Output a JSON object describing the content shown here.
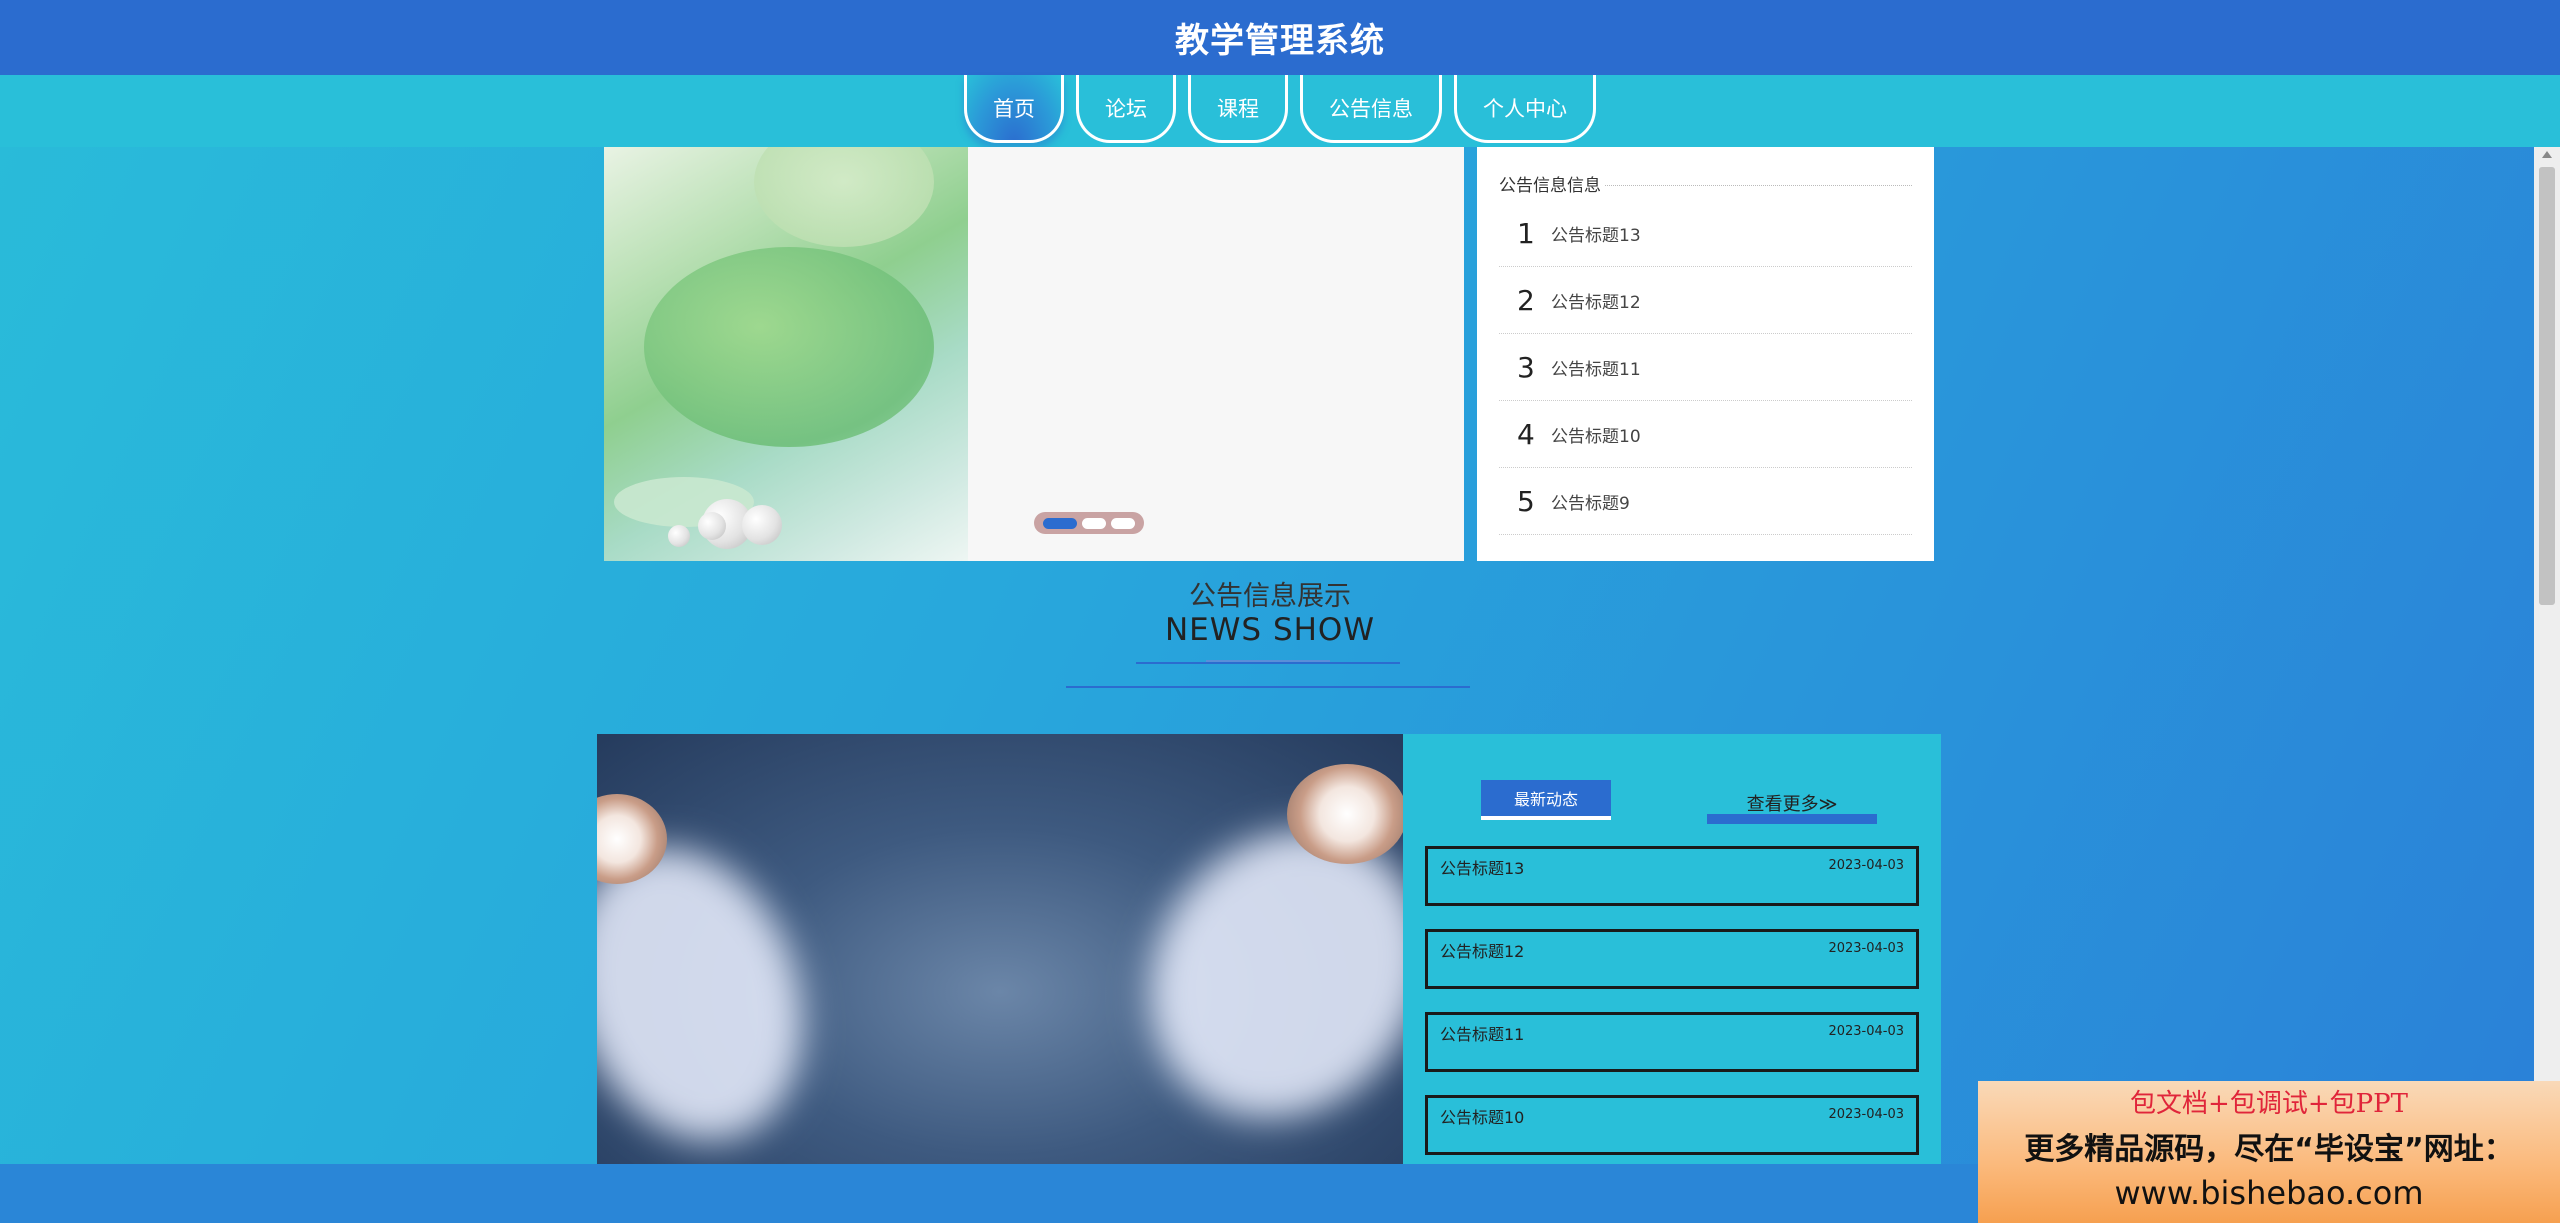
{
  "header": {
    "title": "教学管理系统"
  },
  "nav": {
    "items": [
      {
        "label": "首页"
      },
      {
        "label": "论坛"
      },
      {
        "label": "课程"
      },
      {
        "label": "公告信息"
      },
      {
        "label": "个人中心"
      }
    ]
  },
  "notice_panel": {
    "heading": "公告信息信息",
    "items": [
      {
        "num": "1",
        "title": "公告标题13"
      },
      {
        "num": "2",
        "title": "公告标题12"
      },
      {
        "num": "3",
        "title": "公告标题11"
      },
      {
        "num": "4",
        "title": "公告标题10"
      },
      {
        "num": "5",
        "title": "公告标题9"
      }
    ]
  },
  "section": {
    "title_cn": "公告信息展示",
    "title_en": "NEWS SHOW"
  },
  "news": {
    "tab_latest": "最新动态",
    "tab_more": "查看更多≫",
    "items": [
      {
        "title": "公告标题13",
        "date": "2023-04-03"
      },
      {
        "title": "公告标题12",
        "date": "2023-04-03"
      },
      {
        "title": "公告标题11",
        "date": "2023-04-03"
      },
      {
        "title": "公告标题10",
        "date": "2023-04-03"
      }
    ]
  },
  "watermark": {
    "line1": "包文档+包调试+包PPT",
    "line2": "更多精品源码，尽在“毕设宝”网址：",
    "line3": "www.bishebao.com"
  },
  "colors": {
    "primary": "#2b6ccf",
    "cyan": "#29bfd9",
    "watermark_red": "#e0253a"
  }
}
